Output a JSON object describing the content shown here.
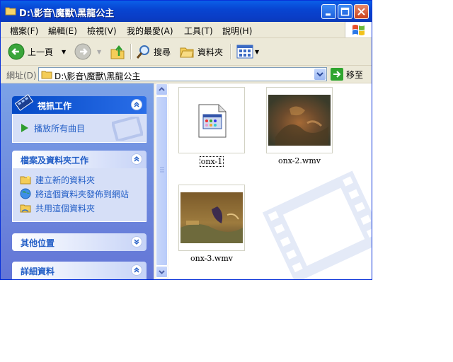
{
  "window": {
    "title": "D:\\影音\\魔獸\\黑龍公主"
  },
  "menu": [
    "檔案(F)",
    "編輯(E)",
    "檢視(V)",
    "我的最愛(A)",
    "工具(T)",
    "說明(H)"
  ],
  "toolbar": {
    "back": "上一頁",
    "search": "搜尋",
    "folders": "資料夾"
  },
  "address": {
    "label": "網址(D)",
    "value": "D:\\影音\\魔獸\\黑龍公主",
    "go": "移至"
  },
  "tasks": {
    "video": {
      "header": "視訊工作",
      "items": [
        "播放所有曲目"
      ]
    },
    "file": {
      "header": "檔案及資料夾工作",
      "items": [
        "建立新的資料夾",
        "將這個資料夾發佈到網站",
        "共用這個資料夾"
      ]
    },
    "other": {
      "header": "其他位置"
    },
    "details": {
      "header": "詳細資料"
    }
  },
  "files": [
    {
      "name": "onx-1",
      "kind": "generic-video-file-icon",
      "selected": true
    },
    {
      "name": "onx-2.wmv",
      "kind": "video-thumbnail"
    },
    {
      "name": "onx-3.wmv",
      "kind": "video-thumbnail"
    }
  ]
}
